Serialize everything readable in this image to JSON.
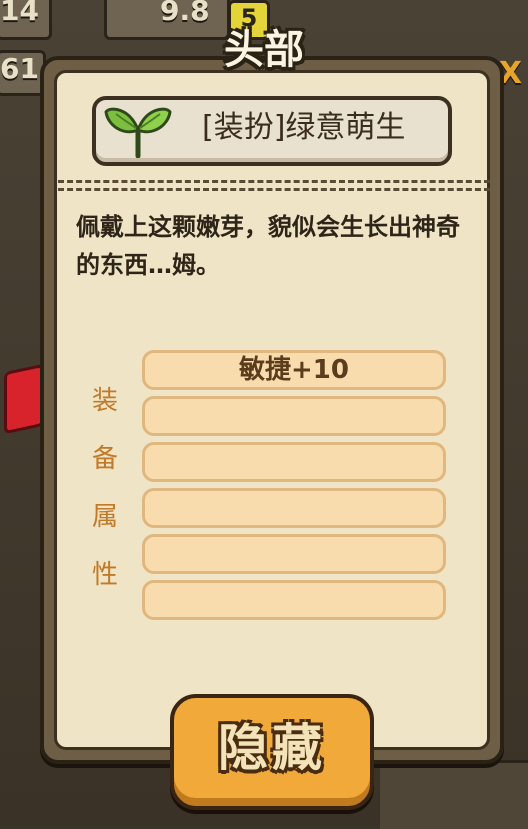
{
  "background": {
    "stat_left_top": "14",
    "stat_value": "9.8",
    "level_badge": "5",
    "stat_left_second": "61"
  },
  "panel": {
    "title": "头部",
    "item_name": "[装扮]绿意萌生",
    "item_icon": "sprout-icon",
    "description": "佩戴上这颗嫩芽，貌似会生长出神奇的东西…姆。",
    "attributes_label": [
      "装",
      "备",
      "属",
      "性"
    ],
    "attribute_slots": [
      "敏捷+10",
      "",
      "",
      "",
      "",
      ""
    ],
    "hide_button_label": "隐藏"
  },
  "colors": {
    "panel_bg": "#efe4c6",
    "slot_bg": "#f8dcae",
    "button_orange": "#f1a93a",
    "label_orange": "#c07a2a"
  }
}
